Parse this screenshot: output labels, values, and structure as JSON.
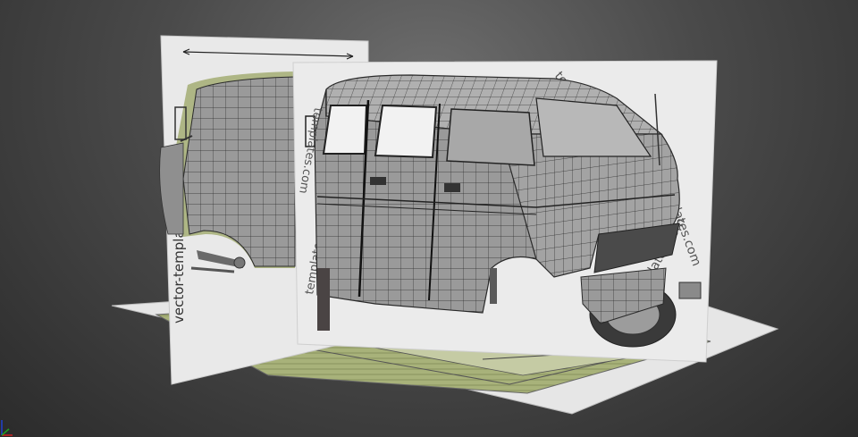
{
  "viewport": {
    "background_top": "#6e6e6e",
    "background_bottom": "#2b2b2b"
  },
  "scene": {
    "watermark": "vector-templates.com",
    "watermark_short": "templates.com",
    "blueprint_green": "#a8b27a",
    "blueprint_gray": "#e4e4e4",
    "model_wire_color": "#2a2a2a",
    "model_shade": "#9a9a9a"
  },
  "gizmo": {
    "x_color": "#d02020",
    "y_color": "#20a020",
    "z_color": "#2040d0"
  }
}
